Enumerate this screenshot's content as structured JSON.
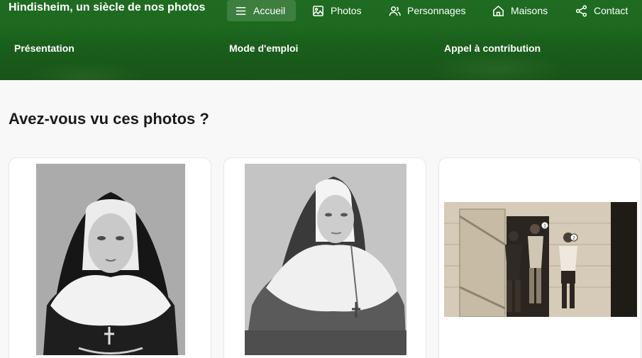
{
  "header": {
    "brand": "Hindisheim, un siècle de nos photos",
    "nav": [
      {
        "label": "Accueil",
        "icon": "menu-icon",
        "active": true
      },
      {
        "label": "Photos",
        "icon": "image-icon",
        "active": false
      },
      {
        "label": "Personnages",
        "icon": "users-icon",
        "active": false
      },
      {
        "label": "Maisons",
        "icon": "house-icon",
        "active": false
      },
      {
        "label": "Contact",
        "icon": "share-icon",
        "active": false
      }
    ],
    "subnav": [
      "Présentation",
      "Mode d'emploi",
      "Appel à contribution"
    ]
  },
  "main": {
    "title": "Avez-vous vu ces photos ?",
    "cards": [
      {
        "photo": "portrait-nun-1"
      },
      {
        "photo": "portrait-nun-2"
      },
      {
        "photo": "men-at-barn-door",
        "markers": [
          "1",
          "2"
        ]
      }
    ]
  },
  "colors": {
    "header_green": "#1d6a1f",
    "text": "#1b1b1b",
    "background": "#f8f8f8"
  }
}
